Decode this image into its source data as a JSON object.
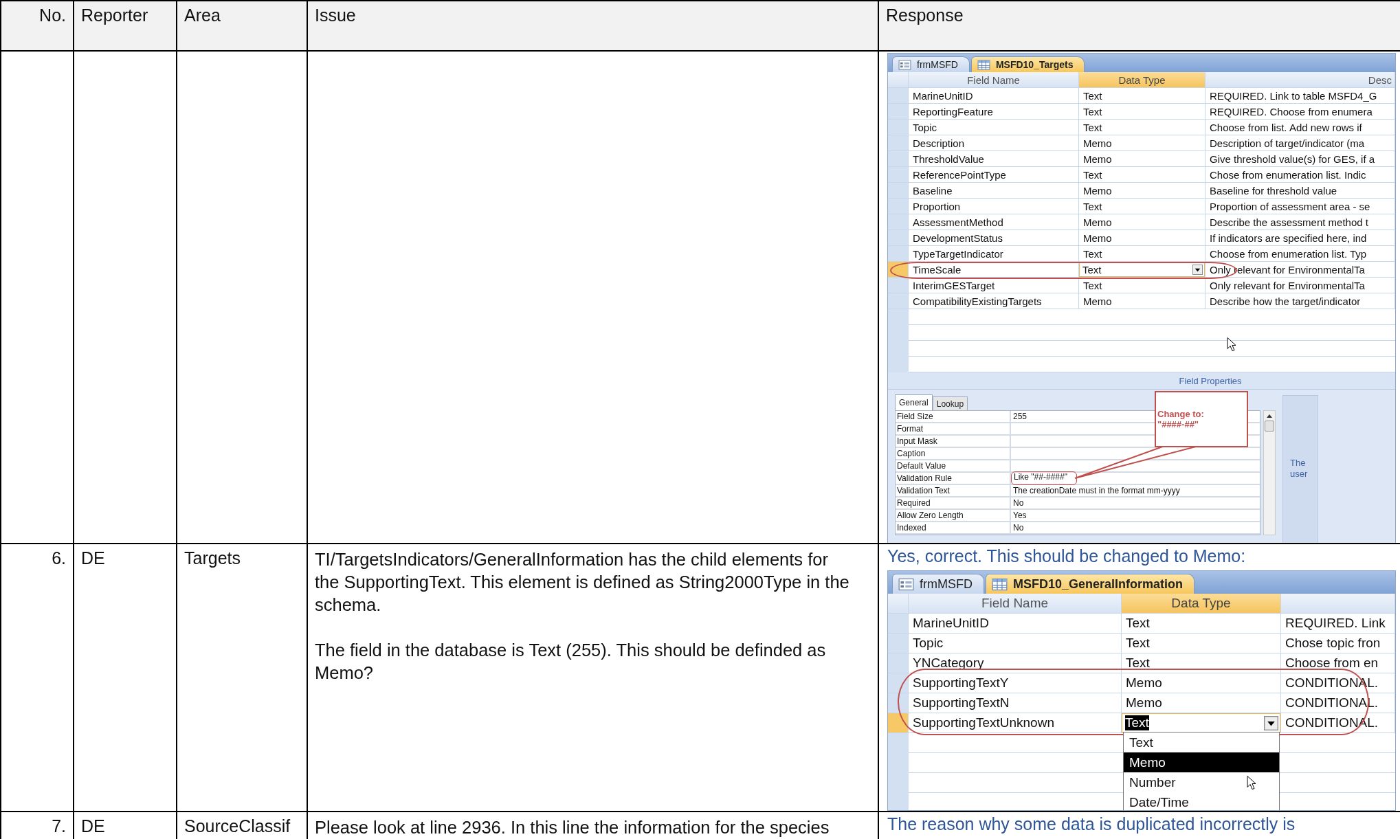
{
  "table": {
    "columns": [
      "No.",
      "Reporter",
      "Area",
      "Issue",
      "Response"
    ],
    "rows": [
      {
        "response": {
          "screenshot": {
            "tabs": [
              {
                "label": "frmMSFD",
                "kind": "form",
                "selected": false
              },
              {
                "label": "MSFD10_Targets",
                "kind": "table",
                "selected": true
              }
            ],
            "columns": [
              "Field Name",
              "Data Type",
              "Desc"
            ],
            "fields": [
              {
                "name": "MarineUnitID",
                "type": "Text",
                "description": "REQUIRED. Link to table MSFD4_G",
                "selected": false,
                "circled": false
              },
              {
                "name": "ReportingFeature",
                "type": "Text",
                "description": "REQUIRED. Choose from enumera",
                "selected": false,
                "circled": false
              },
              {
                "name": "Topic",
                "type": "Text",
                "description": "Choose from list. Add new  rows if",
                "selected": false,
                "circled": false
              },
              {
                "name": "Description",
                "type": "Memo",
                "description": "Description of target/indicator (ma",
                "selected": false,
                "circled": false
              },
              {
                "name": "ThresholdValue",
                "type": "Memo",
                "description": "Give threshold value(s) for GES, if a",
                "selected": false,
                "circled": false
              },
              {
                "name": "ReferencePointType",
                "type": "Text",
                "description": "Chose from enumeration list. Indic",
                "selected": false,
                "circled": false
              },
              {
                "name": "Baseline",
                "type": "Memo",
                "description": "Baseline for threshold value",
                "selected": false,
                "circled": false
              },
              {
                "name": "Proportion",
                "type": "Text",
                "description": "Proportion of assessment area - se",
                "selected": false,
                "circled": false
              },
              {
                "name": "AssessmentMethod",
                "type": "Memo",
                "description": "Describe the assessment method t",
                "selected": false,
                "circled": false
              },
              {
                "name": "DevelopmentStatus",
                "type": "Memo",
                "description": "If indicators are specified here, ind",
                "selected": false,
                "circled": false
              },
              {
                "name": "TypeTargetIndicator",
                "type": "Text",
                "description": "Choose from enumeration list. Typ",
                "selected": false,
                "circled": false
              },
              {
                "name": "TimeScale",
                "type": "Text",
                "description": "Only relevant for EnvironmentalTa",
                "selected": true,
                "circled": true
              },
              {
                "name": "InterimGESTarget",
                "type": "Text",
                "description": "Only relevant for EnvironmentalTa",
                "selected": false,
                "circled": false
              },
              {
                "name": "CompatibilityExistingTargets",
                "type": "Memo",
                "description": "Describe how the target/indicator",
                "selected": false,
                "circled": false
              }
            ],
            "field_properties": {
              "title": "Field Properties",
              "tabs": [
                {
                  "label": "General",
                  "selected": true
                },
                {
                  "label": "Lookup",
                  "selected": false
                }
              ],
              "properties": [
                {
                  "name": "Field Size",
                  "value": "255",
                  "circled": false
                },
                {
                  "name": "Format",
                  "circled": false
                },
                {
                  "name": "Input Mask",
                  "circled": false
                },
                {
                  "name": "Caption",
                  "circled": false
                },
                {
                  "name": "Default Value",
                  "circled": false
                },
                {
                  "name": "Validation Rule",
                  "value": "Like \"##-####\"",
                  "circled": true
                },
                {
                  "name": "Validation Text",
                  "value": "The creationDate must in the format mm-yyyy",
                  "circled": false
                },
                {
                  "name": "Required",
                  "value": "No",
                  "circled": false
                },
                {
                  "name": "Allow Zero Length",
                  "value": "Yes",
                  "circled": false
                },
                {
                  "name": "Indexed",
                  "value": "No",
                  "circled": false
                }
              ],
              "callout": "Change to:\n\"####-##\"",
              "help_text": "The user"
            }
          }
        }
      },
      {
        "no": "6.",
        "reporter": "DE",
        "area": "Targets",
        "issue": [
          "TI/TargetsIndicators/GeneralInformation has the child elements for the SupportingText. This element is defined as String2000Type in the schema.",
          "The field in the database is Text (255). This should be definded as Memo?"
        ],
        "response": {
          "text": "Yes, correct. This should be changed to Memo:",
          "screenshot": {
            "tabs": [
              {
                "label": "frmMSFD",
                "kind": "form",
                "selected": false
              },
              {
                "label": "MSFD10_GeneralInformation",
                "kind": "table",
                "selected": true
              }
            ],
            "columns": [
              "Field Name",
              "Data Type"
            ],
            "fields": [
              {
                "name": "MarineUnitID",
                "type": "Text",
                "description": "REQUIRED. Link",
                "selected": false,
                "circled": false
              },
              {
                "name": "Topic",
                "type": "Text",
                "description": "Chose topic fron",
                "selected": false,
                "circled": false
              },
              {
                "name": "YNCategory",
                "type": "Text",
                "description": "Choose from en",
                "selected": false,
                "circled": false
              },
              {
                "name": "SupportingTextY",
                "type": "Memo",
                "description": "CONDITIONAL.",
                "selected": false,
                "circled": true
              },
              {
                "name": "SupportingTextN",
                "type": "Memo",
                "description": "CONDITIONAL.",
                "selected": false,
                "circled": true
              },
              {
                "name": "SupportingTextUnknown",
                "type": "Text",
                "description": "CONDITIONAL.",
                "selected": true,
                "circled": true,
                "dropdown": [
                  {
                    "label": "Text",
                    "selected": false
                  },
                  {
                    "label": "Memo",
                    "selected": true
                  },
                  {
                    "label": "Number",
                    "selected": false
                  },
                  {
                    "label": "Date/Time",
                    "selected": false
                  }
                ]
              }
            ]
          }
        }
      },
      {
        "no": "7.",
        "reporter": "DE",
        "area": "SourceClassif",
        "issue": [
          "Please look at line 2936. In this line the information for the species"
        ],
        "response": {
          "text": "The reason why some data is duplicated incorrectly is"
        }
      }
    ]
  }
}
